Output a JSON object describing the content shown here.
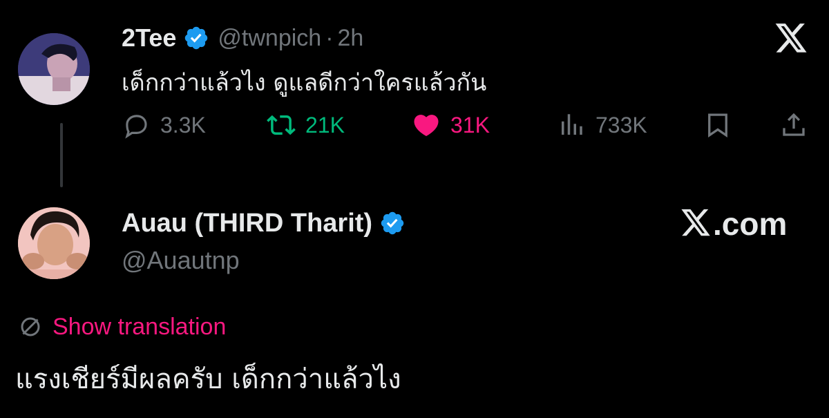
{
  "tweet_1": {
    "display_name": "2Tee",
    "handle": "@twnpich",
    "separator": "·",
    "time": "2h",
    "text": "เด็กกว่าแล้วไง ดูแลดีกว่าใครแล้วกัน",
    "verified": true,
    "actions": {
      "replies": "3.3K",
      "reposts": "21K",
      "likes": "31K",
      "views": "733K"
    }
  },
  "tweet_2": {
    "display_name": "Auau (THIRD Tharit)",
    "handle": "@Auautnp",
    "verified": true,
    "show_translation": "Show translation",
    "text": "แรงเชียร์มีผลครับ เด็กกว่าแล้วไง"
  },
  "branding": {
    "site": ".com"
  },
  "colors": {
    "background": "#000000",
    "text": "#e7e9ea",
    "muted": "#71767b",
    "verified": "#1d9bf0",
    "repost": "#00ba7c",
    "like": "#f91880"
  },
  "icons": [
    "x-logo-icon",
    "verified-badge-icon",
    "reply-icon",
    "repost-icon",
    "like-heart-icon",
    "views-icon",
    "bookmark-icon",
    "share-icon",
    "translate-icon"
  ]
}
